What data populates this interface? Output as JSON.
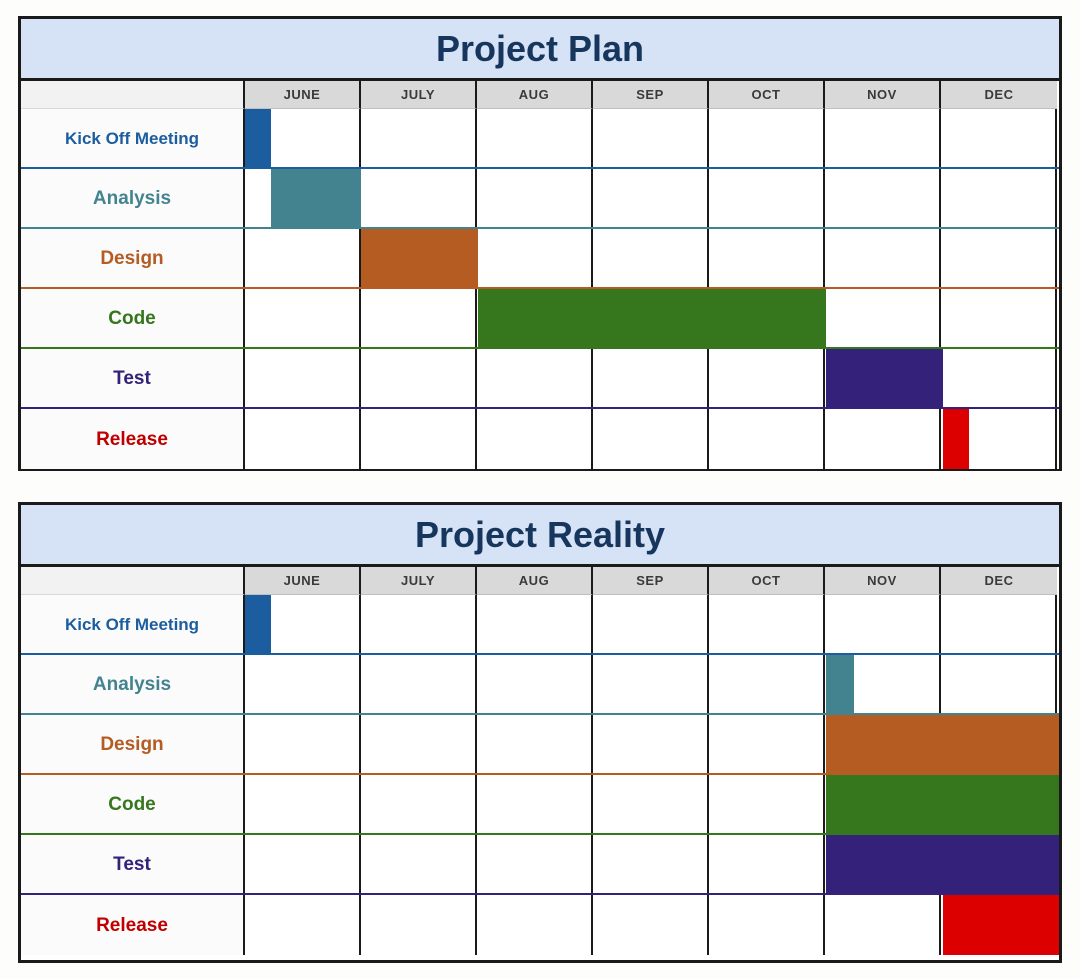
{
  "chart_data": [
    {
      "type": "bar",
      "chart_kind": "gantt",
      "title": "Project Plan",
      "xlabel": "",
      "ylabel": "",
      "categories": [
        "JUNE",
        "JULY",
        "AUG",
        "SEP",
        "OCT",
        "NOV",
        "DEC"
      ],
      "tasks": [
        {
          "name": "Kick Off Meeting",
          "color": "#1b5d9e",
          "start_month": "JUNE",
          "end_month": "JUNE",
          "start_frac": 0.0,
          "end_frac": 0.22,
          "bar_left_pct": 0.0,
          "bar_width_pct": 3.2
        },
        {
          "name": "Analysis",
          "color": "#43838f",
          "start_month": "JUNE",
          "end_month": "JUNE",
          "start_frac": 0.22,
          "end_frac": 1.0,
          "bar_left_pct": 3.2,
          "bar_width_pct": 11.1
        },
        {
          "name": "Design",
          "color": "#b45c22",
          "start_month": "JULY",
          "end_month": "JULY",
          "start_frac": 0.0,
          "end_frac": 1.0,
          "bar_left_pct": 14.3,
          "bar_width_pct": 14.3
        },
        {
          "name": "Code",
          "color": "#36761c",
          "start_month": "AUG",
          "end_month": "OCT",
          "start_frac": 0.0,
          "end_frac": 1.0,
          "bar_left_pct": 28.6,
          "bar_width_pct": 42.8
        },
        {
          "name": "Test",
          "color": "#34227a",
          "start_month": "NOV",
          "end_month": "NOV",
          "start_frac": 0.0,
          "end_frac": 1.0,
          "bar_left_pct": 71.4,
          "bar_width_pct": 14.3
        },
        {
          "name": "Release",
          "color": "#dd0000",
          "start_month": "DEC",
          "end_month": "DEC",
          "start_frac": 0.0,
          "end_frac": 0.22,
          "bar_left_pct": 85.7,
          "bar_width_pct": 3.2
        }
      ]
    },
    {
      "type": "bar",
      "chart_kind": "gantt",
      "title": "Project Reality",
      "xlabel": "",
      "ylabel": "",
      "categories": [
        "JUNE",
        "JULY",
        "AUG",
        "SEP",
        "OCT",
        "NOV",
        "DEC"
      ],
      "tasks": [
        {
          "name": "Kick Off Meeting",
          "color": "#1b5d9e",
          "start_month": "JUNE",
          "end_month": "JUNE",
          "start_frac": 0.0,
          "end_frac": 0.22,
          "bar_left_pct": 0.0,
          "bar_width_pct": 3.2
        },
        {
          "name": "Analysis",
          "color": "#43838f",
          "start_month": "NOV",
          "end_month": "NOV",
          "start_frac": 0.0,
          "end_frac": 0.24,
          "bar_left_pct": 71.4,
          "bar_width_pct": 3.4
        },
        {
          "name": "Design",
          "color": "#b45c22",
          "start_month": "NOV",
          "end_month": "DEC",
          "start_frac": 0.0,
          "end_frac": 1.0,
          "bar_left_pct": 71.4,
          "bar_width_pct": 28.6
        },
        {
          "name": "Code",
          "color": "#36761c",
          "start_month": "NOV",
          "end_month": "DEC",
          "start_frac": 0.0,
          "end_frac": 1.0,
          "bar_left_pct": 71.4,
          "bar_width_pct": 28.6
        },
        {
          "name": "Test",
          "color": "#34227a",
          "start_month": "NOV",
          "end_month": "DEC",
          "start_frac": 0.0,
          "end_frac": 1.0,
          "bar_left_pct": 71.4,
          "bar_width_pct": 28.6
        },
        {
          "name": "Release",
          "color": "#dd0000",
          "start_month": "DEC",
          "end_month": "DEC",
          "start_frac": 0.0,
          "end_frac": 1.0,
          "bar_left_pct": 85.7,
          "bar_width_pct": 14.3
        }
      ]
    }
  ],
  "charts": [
    {
      "id": "plan",
      "title": "Project Plan",
      "months": [
        "JUNE",
        "JULY",
        "AUG",
        "SEP",
        "OCT",
        "NOV",
        "DEC"
      ],
      "rows": [
        {
          "label": "Kick Off Meeting",
          "color": "#1b5d9e",
          "left": "0%",
          "width": "3.2%"
        },
        {
          "label": "Analysis",
          "color": "#43838f",
          "left": "3.2%",
          "width": "11.1%"
        },
        {
          "label": "Design",
          "color": "#b45c22",
          "left": "14.3%",
          "width": "14.3%"
        },
        {
          "label": "Code",
          "color": "#36761c",
          "left": "28.6%",
          "width": "42.8%"
        },
        {
          "label": "Test",
          "color": "#34227a",
          "left": "71.4%",
          "width": "14.3%"
        },
        {
          "label": "Release",
          "color": "#dd0000",
          "left": "85.7%",
          "width": "3.2%"
        }
      ]
    },
    {
      "id": "reality",
      "title": "Project Reality",
      "months": [
        "JUNE",
        "JULY",
        "AUG",
        "SEP",
        "OCT",
        "NOV",
        "DEC"
      ],
      "rows": [
        {
          "label": "Kick Off Meeting",
          "color": "#1b5d9e",
          "left": "0%",
          "width": "3.2%"
        },
        {
          "label": "Analysis",
          "color": "#43838f",
          "left": "71.4%",
          "width": "3.4%"
        },
        {
          "label": "Design",
          "color": "#b45c22",
          "left": "71.4%",
          "width": "28.6%"
        },
        {
          "label": "Code",
          "color": "#36761c",
          "left": "71.4%",
          "width": "28.6%"
        },
        {
          "label": "Test",
          "color": "#34227a",
          "left": "71.4%",
          "width": "28.6%"
        },
        {
          "label": "Release",
          "color": "#dd0000",
          "left": "85.7%",
          "width": "14.3%"
        }
      ]
    }
  ],
  "colors": {
    "title_background": "#d6e2f5",
    "title_text": "#17365d",
    "month_header_background": "#d9d9d9",
    "month_header_text": "#3a3a3a",
    "label_background": "#fbfbfb",
    "border": "#1a1a1a",
    "kick_off": "#1b5d9e",
    "analysis": "#43838f",
    "design": "#b45c22",
    "code": "#36761c",
    "test": "#34227a",
    "release": "#dd0000"
  }
}
